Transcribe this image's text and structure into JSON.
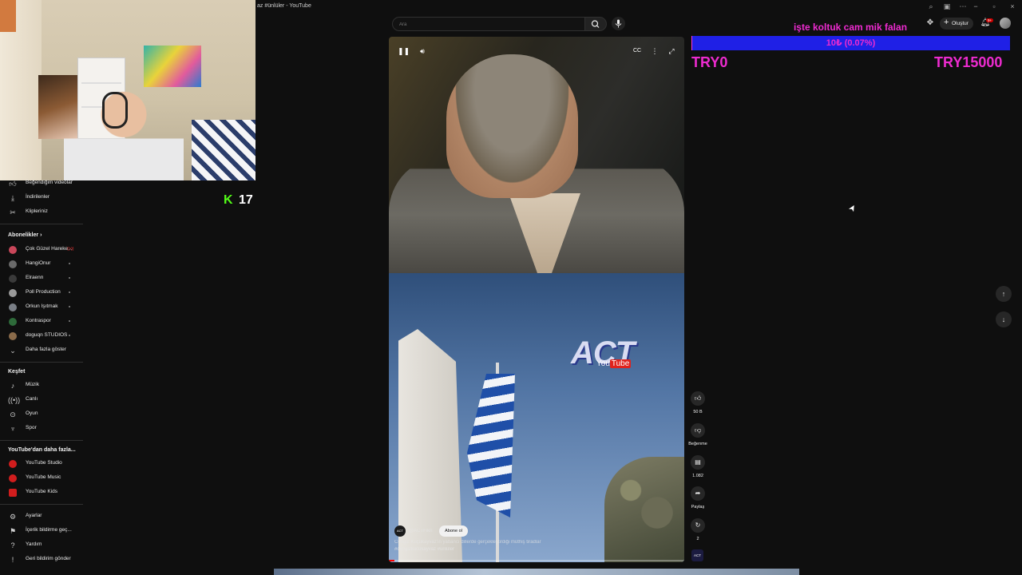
{
  "window": {
    "tab_title": "az #ünlüler - YouTube"
  },
  "kick": {
    "count": "17"
  },
  "sidebar": {
    "top_items": [
      {
        "label": "Beğendiğim videolar",
        "icon": "thumb-up-icon"
      },
      {
        "label": "İndirilenler",
        "icon": "download-icon"
      },
      {
        "label": "Klipleriniz",
        "icon": "scissors-icon"
      }
    ],
    "subscriptions_heading": "Abonelikler",
    "subscriptions": [
      {
        "label": "Çok Güzel Hareke...",
        "live": true
      },
      {
        "label": "HangiOnur"
      },
      {
        "label": "Elraenn"
      },
      {
        "label": "Poll Production"
      },
      {
        "label": "Orkun Işıtmak"
      },
      {
        "label": "Kontraspor"
      },
      {
        "label": "doguqn STUDIOS"
      }
    ],
    "show_more": "Daha fazla göster",
    "explore_heading": "Keşfet",
    "explore": [
      {
        "label": "Müzik",
        "icon": "music-icon"
      },
      {
        "label": "Canlı",
        "icon": "live-icon"
      },
      {
        "label": "Oyun",
        "icon": "gamepad-icon"
      },
      {
        "label": "Spor",
        "icon": "trophy-icon"
      }
    ],
    "more_heading": "YouTube'dan daha fazla...",
    "more": [
      {
        "label": "YouTube Studio"
      },
      {
        "label": "YouTube Music"
      },
      {
        "label": "YouTube Kids"
      }
    ],
    "settings": [
      {
        "label": "Ayarlar",
        "icon": "gear-icon"
      },
      {
        "label": "İçerik bildirme geç...",
        "icon": "flag-icon"
      },
      {
        "label": "Yardım",
        "icon": "help-icon"
      },
      {
        "label": "Geri bildirim gönder",
        "icon": "feedback-icon"
      }
    ]
  },
  "header": {
    "search_placeholder": "Ara",
    "create_label": "Oluştur",
    "notification_count": "9+"
  },
  "donation_goal": {
    "title": "işte koltuk cam mik falan",
    "progress_text": "10₺ (0.07%)",
    "progress_fraction": 0.0007,
    "min_label": "TRY0",
    "max_label": "TRY15000",
    "text_color": "#ee2bd0",
    "bar_color": "#1f20e6"
  },
  "player": {
    "overlay_logo": "ACT",
    "overlay_logo_sub": "You",
    "overlay_logo_tube": "Tube",
    "channel_avatar_text": "ACT",
    "channel_name": "@ACTFikri",
    "subscribe_label": "Abone ol",
    "title": "Cengiz Küçükayvaz'ın yabancı dillerde gerçekleştirdiği müthiş tiradlar",
    "hashtags": "#cengizkücükayvaz #ünlüler",
    "progress_fraction": 0.02
  },
  "actions": {
    "like_count": "50 B",
    "dislike_label": "Beğenme",
    "comment_count": "1.082",
    "share_label": "Paylaş",
    "remix_count": "2",
    "remix_thumb_text": "ACT"
  }
}
